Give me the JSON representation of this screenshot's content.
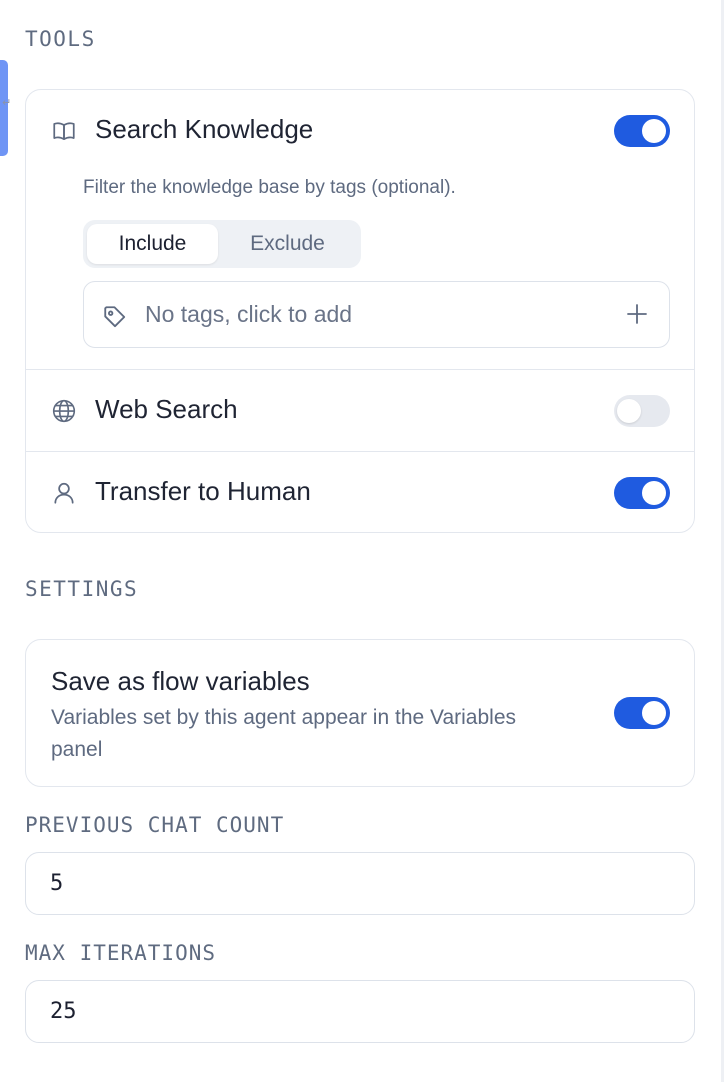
{
  "sections": {
    "tools_label": "TOOLS",
    "settings_label": "SETTINGS"
  },
  "tools": {
    "search_knowledge": {
      "label": "Search Knowledge",
      "icon": "book-icon",
      "enabled": true,
      "hint": "Filter the knowledge base by tags (optional).",
      "filter_mode": {
        "include": "Include",
        "exclude": "Exclude",
        "selected": "Include"
      },
      "tags_placeholder": "No tags, click to add"
    },
    "web_search": {
      "label": "Web Search",
      "icon": "globe-icon",
      "enabled": false
    },
    "transfer_to_human": {
      "label": "Transfer to Human",
      "icon": "user-icon",
      "enabled": true
    }
  },
  "settings": {
    "flow_variables": {
      "title": "Save as flow variables",
      "description": "Variables set by this agent appear in the Variables panel",
      "enabled": true
    },
    "previous_chat_count": {
      "label": "PREVIOUS CHAT COUNT",
      "value": "5"
    },
    "max_iterations": {
      "label": "MAX ITERATIONS",
      "value": "25"
    }
  },
  "colors": {
    "accent": "#1f5be0",
    "toggle_off": "#e6e9ef",
    "border": "#e3e7ee",
    "muted_text": "#5e6a80"
  }
}
